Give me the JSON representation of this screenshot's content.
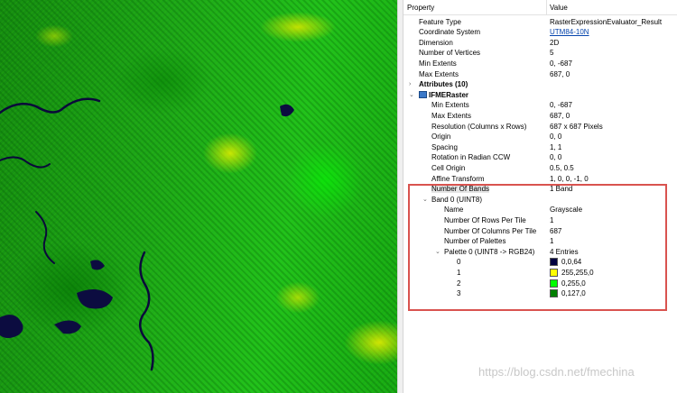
{
  "raster_view": {
    "colors": {
      "water": "#00003F",
      "bare": "#FFFF00",
      "vegetation": "#00FF00",
      "forest": "#007F00"
    }
  },
  "panel": {
    "header": {
      "property": "Property",
      "value": "Value"
    },
    "rows": [
      {
        "key": "Feature Type",
        "value": "RasterExpressionEvaluator_Result"
      },
      {
        "key": "Coordinate System",
        "value": "UTM84-10N",
        "link": true
      },
      {
        "key": "Dimension",
        "value": "2D"
      },
      {
        "key": "Number of Vertices",
        "value": "5"
      },
      {
        "key": "Min Extents",
        "value": "0, -687"
      },
      {
        "key": "Max Extents",
        "value": "687, 0"
      },
      {
        "key": "Attributes (10)",
        "value": "",
        "twisty": ">",
        "bold": true
      },
      {
        "key": "IFMERaster",
        "value": "",
        "twisty": "v",
        "icon": true,
        "bold": true
      },
      {
        "key": "Min Extents",
        "value": "0, -687"
      },
      {
        "key": "Max Extents",
        "value": "687, 0"
      },
      {
        "key": "Resolution (Columns x Rows)",
        "value": "687 x 687 Pixels"
      },
      {
        "key": "Origin",
        "value": "0, 0"
      },
      {
        "key": "Spacing",
        "value": "1, 1"
      },
      {
        "key": "Rotation in Radian CCW",
        "value": "0, 0"
      },
      {
        "key": "Cell Origin",
        "value": "0.5, 0.5"
      },
      {
        "key": "Affine Transform",
        "value": "1, 0, 0, -1, 0"
      },
      {
        "key": "Number Of Bands",
        "value": "1 Band",
        "selected": true
      },
      {
        "key": "Band 0 (UINT8)",
        "value": "",
        "twisty": "v"
      },
      {
        "key": "Name",
        "value": "Grayscale"
      },
      {
        "key": "Number Of Rows Per Tile",
        "value": "1"
      },
      {
        "key": "Number Of Columns Per Tile",
        "value": "687"
      },
      {
        "key": "Number of Palettes",
        "value": "1"
      },
      {
        "key": "Palette 0 (UINT8 -> RGB24)",
        "value": "4 Entries",
        "twisty": "v"
      },
      {
        "key": "0",
        "value": "0,0,64",
        "swatch": "#00003f"
      },
      {
        "key": "1",
        "value": "255,255,0",
        "swatch": "#ffff00"
      },
      {
        "key": "2",
        "value": "0,255,0",
        "swatch": "#00ff00"
      },
      {
        "key": "3",
        "value": "0,127,0",
        "swatch": "#007f00"
      }
    ]
  },
  "watermark": "https://blog.csdn.net/fmechina"
}
